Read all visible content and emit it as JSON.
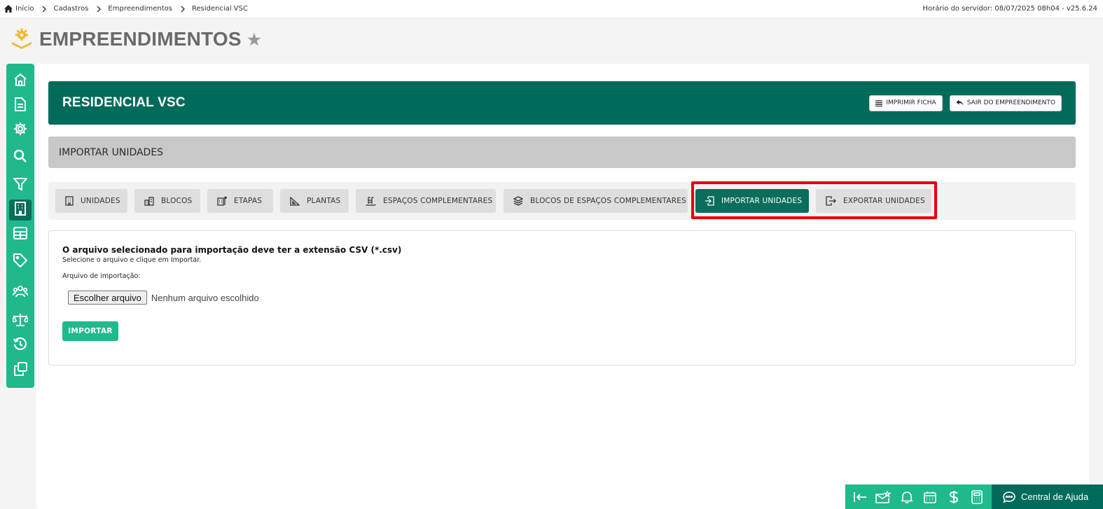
{
  "breadcrumb": {
    "items": [
      "Início",
      "Cadastros",
      "Empreendimentos",
      "Residencial VSC"
    ],
    "server_time": "Horário do servidor: 08/07/2025 08h04 - v25.6.24"
  },
  "header": {
    "title": "EMPREENDIMENTOS"
  },
  "sidebar": {
    "items": [
      {
        "icon": "home-icon"
      },
      {
        "icon": "document-icon"
      },
      {
        "icon": "gear-icon"
      },
      {
        "icon": "search-icon"
      },
      {
        "icon": "filter-icon"
      },
      {
        "icon": "building-icon",
        "active": true
      },
      {
        "icon": "table-icon"
      },
      {
        "icon": "tag-icon"
      },
      {
        "icon": "users-icon"
      },
      {
        "icon": "scale-icon"
      },
      {
        "icon": "history-icon"
      },
      {
        "icon": "copy-icon"
      }
    ]
  },
  "banner": {
    "title": "RESIDENCIAL VSC",
    "print_label": "IMPRIMIR FICHA",
    "exit_label": "SAIR DO EMPREENDIMENTO"
  },
  "section": {
    "title": "IMPORTAR UNIDADES"
  },
  "tabs": [
    {
      "label": "UNIDADES",
      "icon": "building-icon"
    },
    {
      "label": "BLOCOS",
      "icon": "buildings-icon"
    },
    {
      "label": "ETAPAS",
      "icon": "flag-building-icon"
    },
    {
      "label": "PLANTAS",
      "icon": "blueprint-icon"
    },
    {
      "label": "ESPAÇOS COMPLEMENTARES",
      "icon": "pool-icon"
    },
    {
      "label": "BLOCOS DE ESPAÇOS COMPLEMENTARES",
      "icon": "layers-icon"
    },
    {
      "label": "IMPORTAR UNIDADES",
      "icon": "import-icon",
      "active": true
    },
    {
      "label": "EXPORTAR UNIDADES",
      "icon": "export-icon"
    }
  ],
  "import_form": {
    "heading": "O arquivo selecionado para importação deve ter a extensão CSV (*.csv)",
    "subtext": "Selecione o arquivo e clique em Importar.",
    "file_label": "Arquivo de importação:",
    "choose_button": "Escolher arquivo",
    "file_status": "Nenhum arquivo escolhido",
    "submit_label": "IMPORTAR"
  },
  "dock": {
    "icons": [
      "collapse-icon",
      "mail-star-icon",
      "bell-icon",
      "calendar-icon",
      "dollar-icon",
      "calculator-icon"
    ],
    "help_label": "Central de Ajuda"
  },
  "colors": {
    "brand_dark": "#006b5b",
    "brand_light": "#1fb98c",
    "highlight": "#e8000b"
  }
}
